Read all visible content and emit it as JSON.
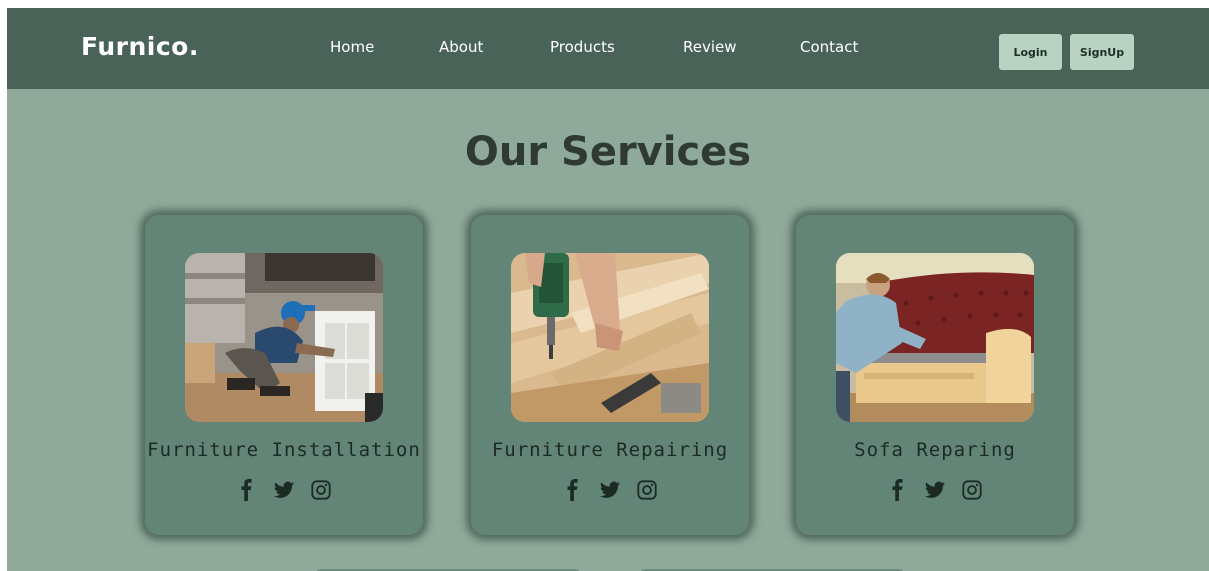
{
  "header": {
    "logo": "Furnico.",
    "nav": [
      {
        "label": "Home"
      },
      {
        "label": "About"
      },
      {
        "label": "Products"
      },
      {
        "label": "Review"
      },
      {
        "label": "Contact"
      }
    ],
    "login_label": "Login",
    "signup_label": "SignUp"
  },
  "main": {
    "title": "Our Services",
    "cards": [
      {
        "title": "Furniture Installation",
        "image": "worker-assembling-shelf"
      },
      {
        "title": "Furniture Repairing",
        "image": "drill-on-wood-frame"
      },
      {
        "title": "Sofa Reparing",
        "image": "man-upholstering-sofa"
      }
    ],
    "social_icons": [
      "facebook-icon",
      "twitter-icon",
      "instagram-icon"
    ]
  },
  "colors": {
    "navbar": "#4a6358",
    "page_bg": "#8faa9a",
    "card_bg": "#628577",
    "button_bg": "#b9d3c2",
    "title_text": "#2f3a34"
  }
}
